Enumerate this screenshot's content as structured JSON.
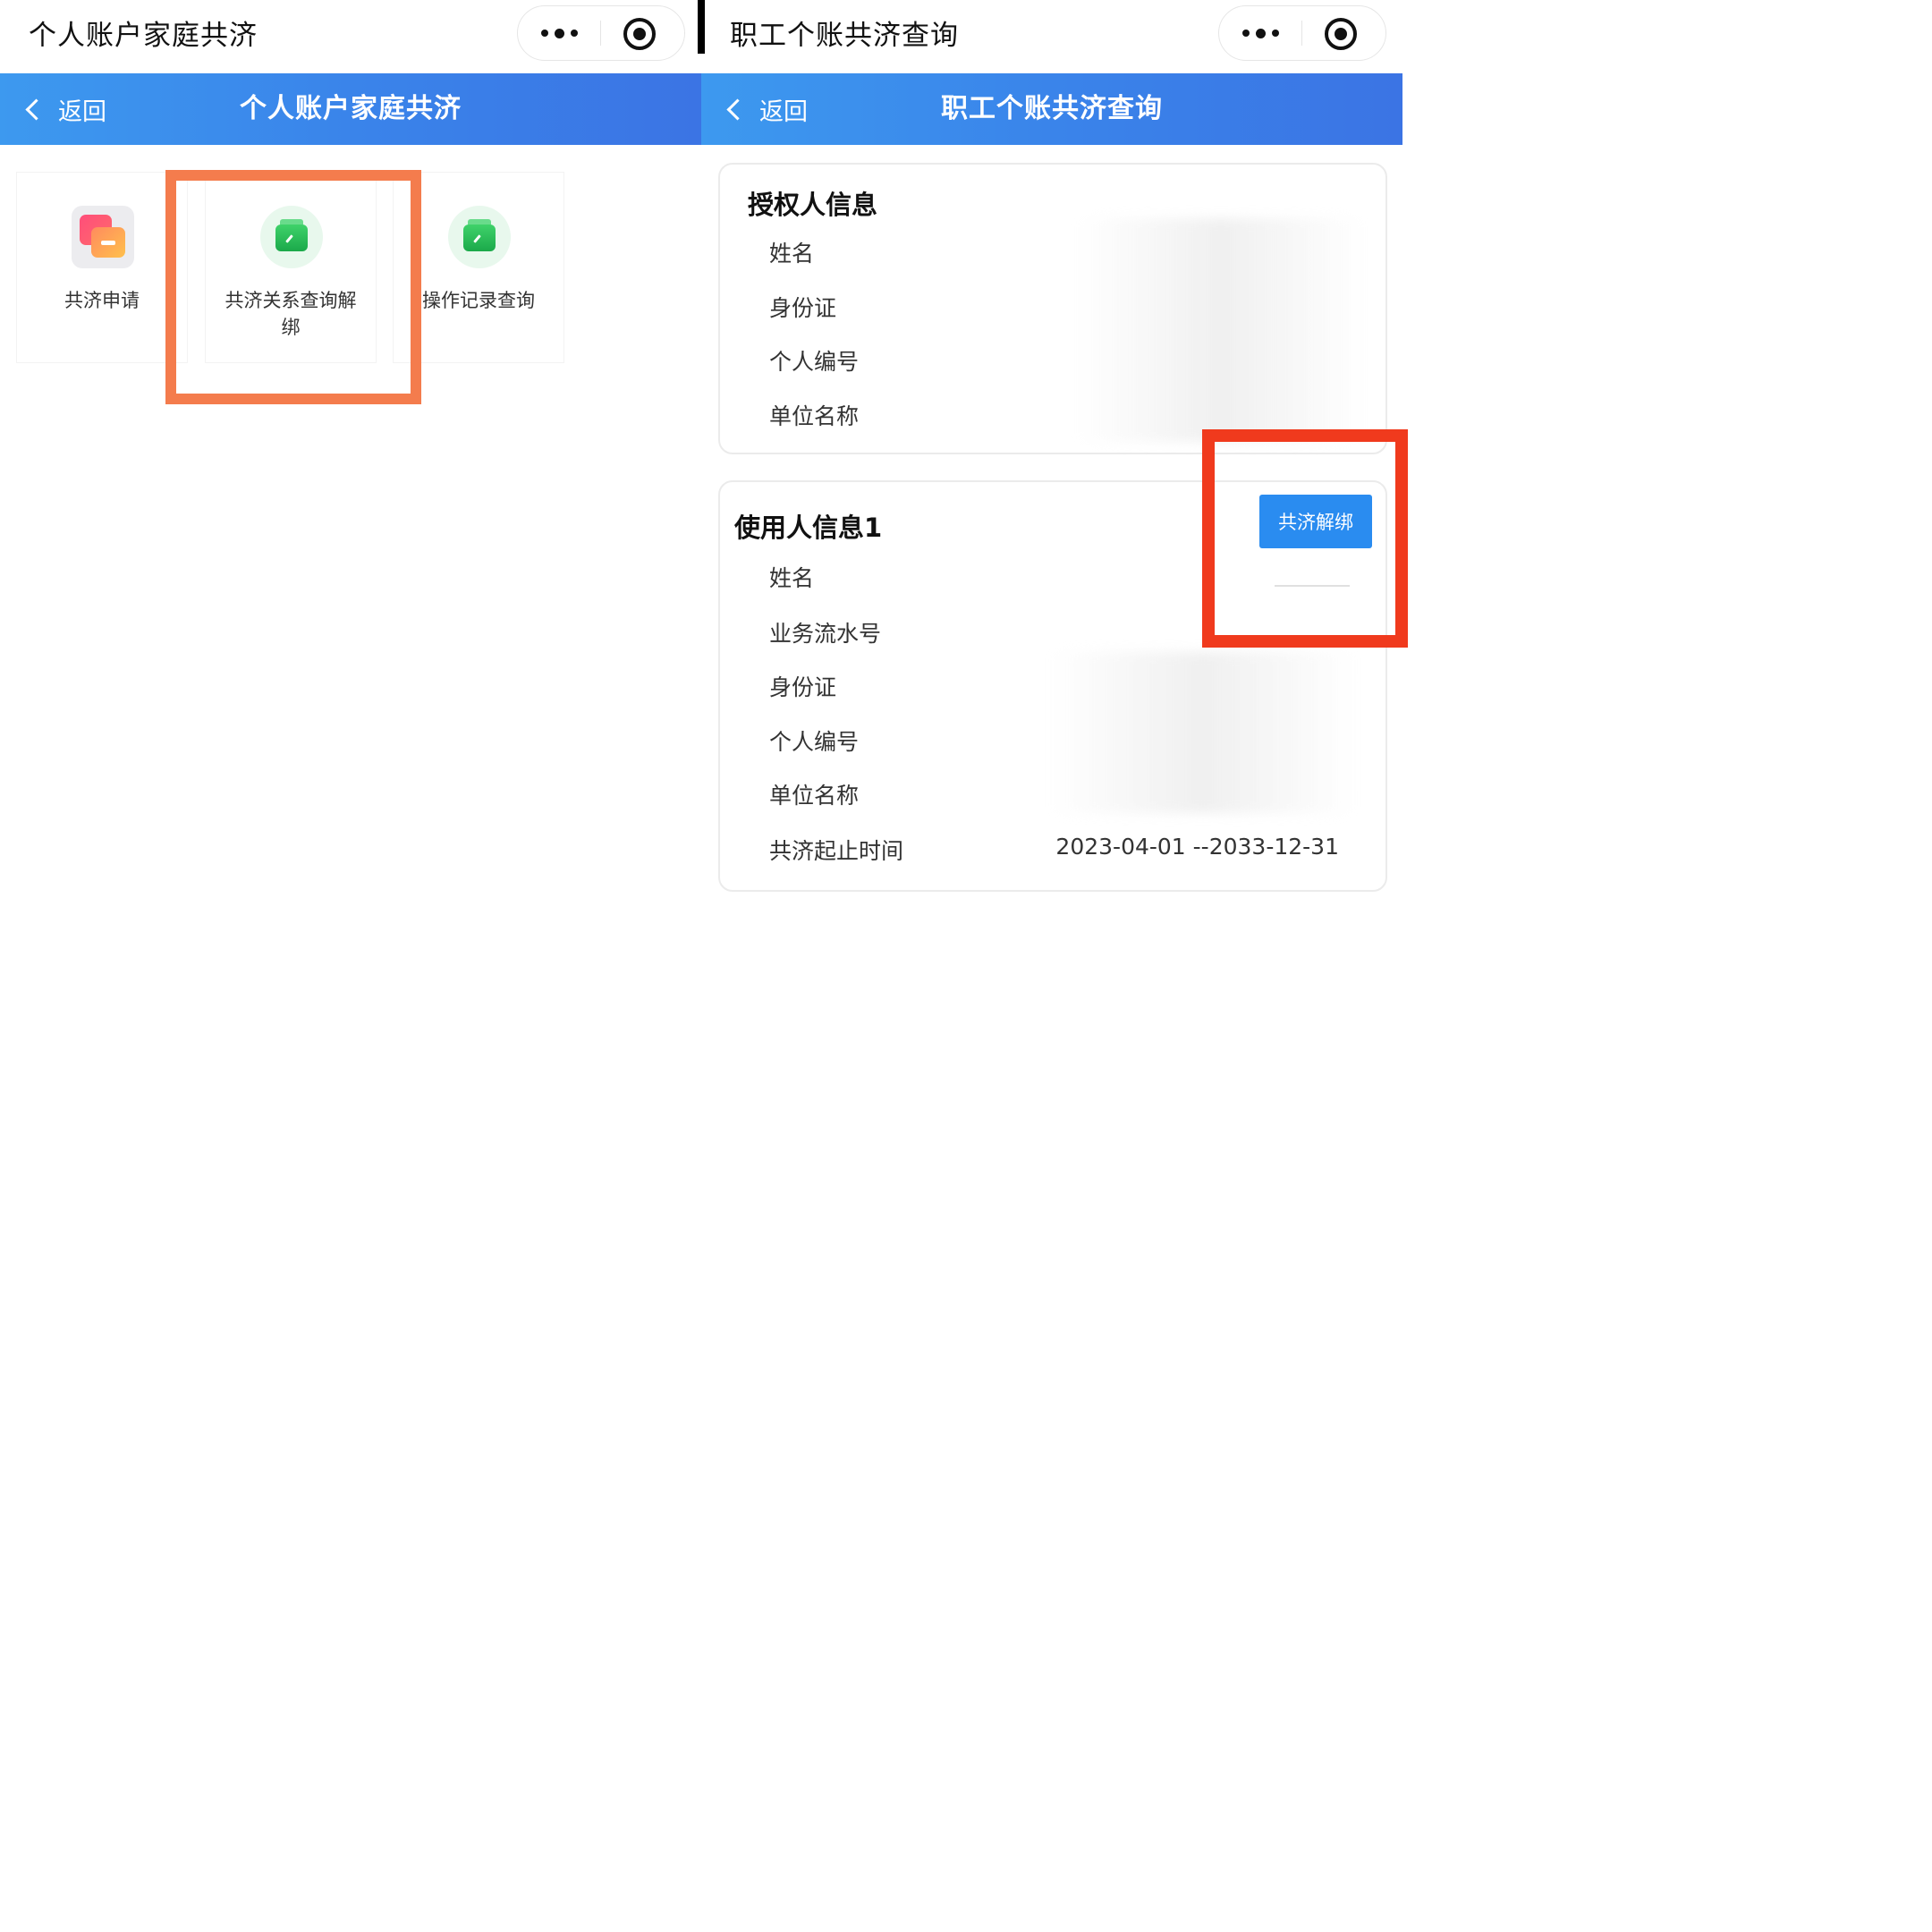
{
  "left": {
    "window_title": "个人账户家庭共济",
    "nav": {
      "back_label": "返回",
      "title": "个人账户家庭共济"
    },
    "tiles": [
      {
        "label": "共济申请",
        "icon": "stacked-cards-icon"
      },
      {
        "label": "共济关系查询解绑",
        "icon": "green-wallet-icon"
      },
      {
        "label": "操作记录查询",
        "icon": "green-wallet-icon"
      }
    ],
    "highlight_color": "#f47c4d"
  },
  "right": {
    "window_title": "职工个账共济查询",
    "nav": {
      "back_label": "返回",
      "title": "职工个账共济查询"
    },
    "authorizer": {
      "title": "授权人信息",
      "rows": [
        "姓名",
        "身份证",
        "个人编号",
        "单位名称"
      ]
    },
    "user": {
      "title": "使用人信息1",
      "unbind_button": "共济解绑",
      "rows": [
        "姓名",
        "业务流水号",
        "身份证",
        "个人编号",
        "单位名称",
        "共济起止时间"
      ],
      "period_value": "2023-04-01 --2033-12-31"
    },
    "highlight_color": "#f03a1d"
  },
  "colors": {
    "nav_start": "#3d99ef",
    "nav_end": "#3b74e4",
    "button": "#2a8cf0"
  }
}
